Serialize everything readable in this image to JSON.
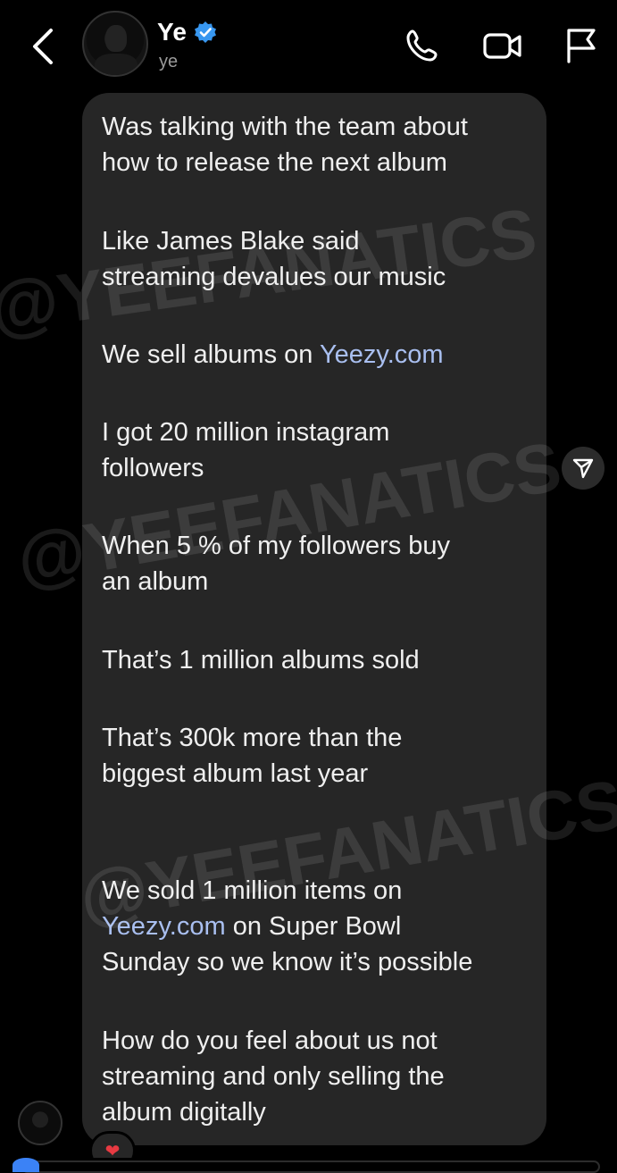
{
  "header": {
    "name": "Ye",
    "handle": "ye",
    "icons": {
      "back": "chevron-left-icon",
      "verified": "verified-badge-icon",
      "phone": "phone-icon",
      "video": "video-camera-icon",
      "flag": "flag-icon"
    },
    "verified_color": "#3897f0"
  },
  "messages": {
    "m1": "Was talking with the team about\nhow to release the next album",
    "m2": "Like James Blake said\nstreaming devalues our music",
    "m3_prefix": "We sell albums on ",
    "m3_link": "Yeezy.com",
    "m4": "I got 20 million instagram\nfollowers",
    "m5": "When 5 % of my followers buy\nan album",
    "m6": "That’s 1 million albums sold",
    "m7": "That’s 300k more than the\nbiggest album last year",
    "m8_prefix": "We sold 1 million items on",
    "m8_link": "Yeezy.com",
    "m8_mid": " on Super Bowl",
    "m8_suffix": "Sunday so we know it’s possible",
    "m9": "How do you feel about us not\nstreaming and only selling the\nalbum digitally"
  },
  "watermark": {
    "wm1": "@YEEFANATICS",
    "wm2": "@YEEFANATICS",
    "wm3": "@YEEFANATICS"
  },
  "reaction": "❤",
  "colors": {
    "background": "#000000",
    "bubble": "#262626",
    "link": "#a9bff0",
    "reaction": "#e83a42"
  }
}
